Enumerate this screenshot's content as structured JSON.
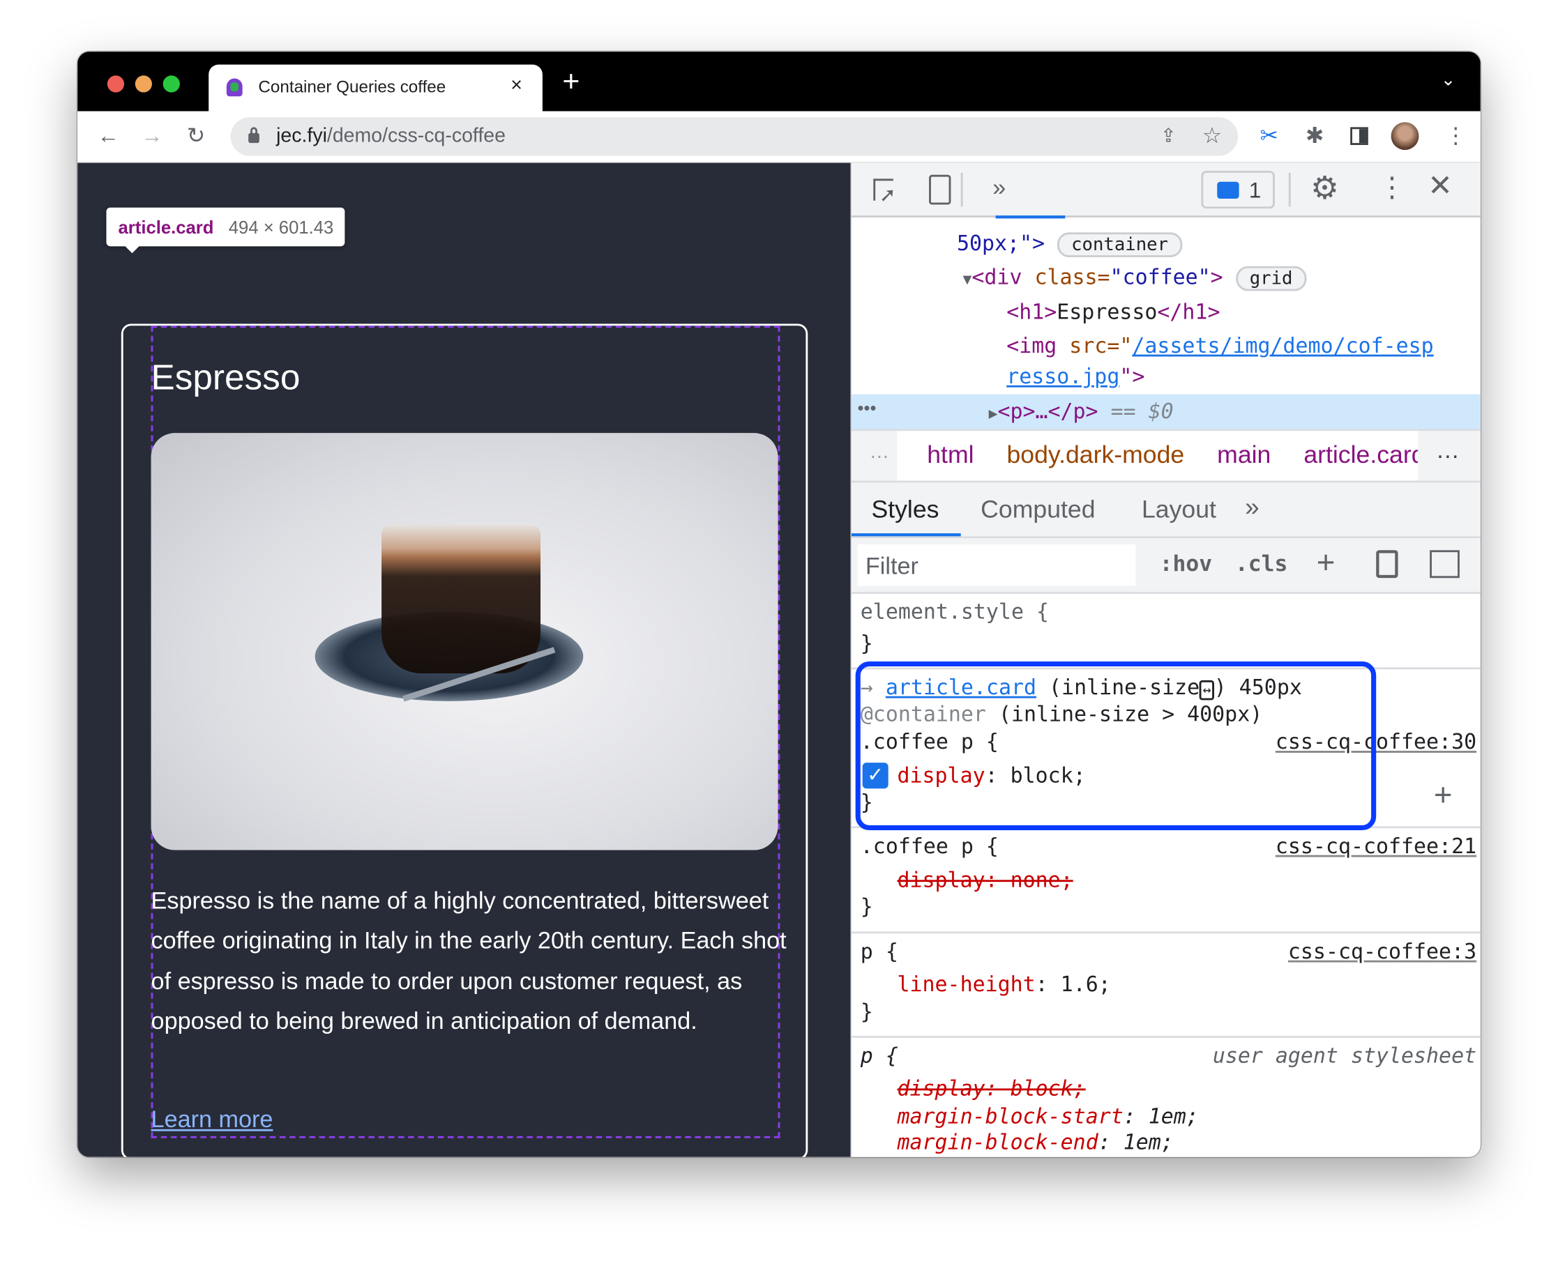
{
  "browser": {
    "tab_title": "Container Queries coffee",
    "url_host": "jec.fyi",
    "url_path": "/demo/css-cq-coffee",
    "new_tab": "+",
    "close_tab": "×"
  },
  "tooltip": {
    "selector": "article.card",
    "size": "494 × 601.43"
  },
  "card": {
    "title": "Espresso",
    "body": "Espresso is the name of a highly concentrated, bittersweet coffee originating in Italy in the early 20th century. Each shot of espresso is made to order upon customer request, as opposed to being brewed in anticipation of demand.",
    "link": "Learn more"
  },
  "devtools": {
    "issues_count": "1",
    "elements": {
      "line1_val": "50px;\">",
      "badge_container": "container",
      "div_open": "<div",
      "div_attr": "class=",
      "div_val": "\"coffee\"",
      "div_close": ">",
      "badge_grid": "grid",
      "h1_open": "<h1>",
      "h1_text": "Espresso",
      "h1_close": "</h1>",
      "img_open": "<img",
      "img_attr": "src=\"",
      "img_link1": "/assets/img/demo/cof-esp",
      "img_link2": "resso.jpg",
      "img_close": "\">",
      "p_node": "<p>…</p>",
      "p_eq": "== $0"
    },
    "breadcrumbs": [
      "html",
      "body.dark-mode",
      "main",
      "article.card"
    ],
    "tabs": [
      "Styles",
      "Computed",
      "Layout"
    ],
    "filter_placeholder": "Filter",
    "hov": ":hov",
    "cls": ".cls",
    "rules": {
      "element_style": "element.style {",
      "close": "}",
      "cq_link": "article.card",
      "cq_info": "(inline-size",
      "cq_px": ") 450px",
      "cq_at": "@container",
      "cq_cond": "(inline-size > 400px)",
      "r1_sel": ".coffee p {",
      "r1_src": "css-cq-coffee:30",
      "r1_prop": "display",
      "r1_val": ": block;",
      "r2_sel": ".coffee p {",
      "r2_src": "css-cq-coffee:21",
      "r2_decl": "display: none;",
      "r3_sel": "p {",
      "r3_src": "css-cq-coffee:3",
      "r3_prop": "line-height",
      "r3_val": ": 1.6;",
      "r4_sel": "p {",
      "r4_src": "user agent stylesheet",
      "r4_decl1": "display: block;",
      "r4_prop2": "margin-block-start",
      "r4_val2": ": 1em;",
      "r4_prop3": "margin-block-end",
      "r4_val3": ": 1em;"
    }
  },
  "colors": {
    "highlight": "#0a3cff",
    "page_bg": "#282c38",
    "selected_row": "#cfe8fc"
  }
}
